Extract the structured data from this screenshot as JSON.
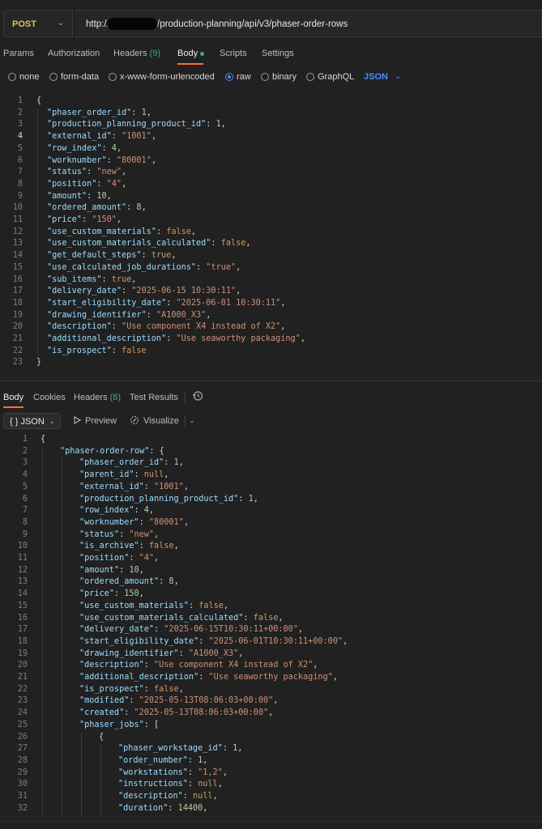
{
  "request": {
    "method": "POST",
    "url_host": "http://",
    "url_path": "/production-planning/api/v3/phaser-order-rows",
    "tabs": [
      {
        "label": "Params"
      },
      {
        "label": "Authorization"
      },
      {
        "label": "Headers",
        "count": "(9)"
      },
      {
        "label": "Body"
      },
      {
        "label": "Scripts"
      },
      {
        "label": "Settings"
      }
    ],
    "body_types": [
      "none",
      "form-data",
      "x-www-form-urlencoded",
      "raw",
      "binary",
      "GraphQL"
    ],
    "selected_body_type": "raw",
    "language": "JSON"
  },
  "request_body_lines": [
    [
      [
        "p",
        "{"
      ]
    ],
    [
      [
        "k",
        "\"phaser_order_id\""
      ],
      [
        "p",
        ": "
      ],
      [
        "n",
        "1"
      ],
      [
        "p",
        ","
      ]
    ],
    [
      [
        "k",
        "\"production_planning_product_id\""
      ],
      [
        "p",
        ": "
      ],
      [
        "n",
        "1"
      ],
      [
        "p",
        ","
      ]
    ],
    [
      [
        "k",
        "\"external_id\""
      ],
      [
        "p",
        ": "
      ],
      [
        "s",
        "\"1001\""
      ],
      [
        "p",
        ","
      ]
    ],
    [
      [
        "k",
        "\"row_index\""
      ],
      [
        "p",
        ": "
      ],
      [
        "n",
        "4"
      ],
      [
        "p",
        ","
      ]
    ],
    [
      [
        "k",
        "\"worknumber\""
      ],
      [
        "p",
        ": "
      ],
      [
        "s",
        "\"80001\""
      ],
      [
        "p",
        ","
      ]
    ],
    [
      [
        "k",
        "\"status\""
      ],
      [
        "p",
        ": "
      ],
      [
        "s",
        "\"new\""
      ],
      [
        "p",
        ","
      ]
    ],
    [
      [
        "k",
        "\"position\""
      ],
      [
        "p",
        ": "
      ],
      [
        "s",
        "\"4\""
      ],
      [
        "p",
        ","
      ]
    ],
    [
      [
        "k",
        "\"amount\""
      ],
      [
        "p",
        ": "
      ],
      [
        "n",
        "10"
      ],
      [
        "p",
        ","
      ]
    ],
    [
      [
        "k",
        "\"ordered_amount\""
      ],
      [
        "p",
        ": "
      ],
      [
        "n",
        "8"
      ],
      [
        "p",
        ","
      ]
    ],
    [
      [
        "k",
        "\"price\""
      ],
      [
        "p",
        ": "
      ],
      [
        "s",
        "\"150\""
      ],
      [
        "p",
        ","
      ]
    ],
    [
      [
        "k",
        "\"use_custom_materials\""
      ],
      [
        "p",
        ": "
      ],
      [
        "b",
        "false"
      ],
      [
        "p",
        ","
      ]
    ],
    [
      [
        "k",
        "\"use_custom_materials_calculated\""
      ],
      [
        "p",
        ": "
      ],
      [
        "b",
        "false"
      ],
      [
        "p",
        ","
      ]
    ],
    [
      [
        "k",
        "\"get_default_steps\""
      ],
      [
        "p",
        ": "
      ],
      [
        "b",
        "true"
      ],
      [
        "p",
        ","
      ]
    ],
    [
      [
        "k",
        "\"use_calculated_job_durations\""
      ],
      [
        "p",
        ": "
      ],
      [
        "s",
        "\"true\""
      ],
      [
        "p",
        ","
      ]
    ],
    [
      [
        "k",
        "\"sub_items\""
      ],
      [
        "p",
        ": "
      ],
      [
        "b",
        "true"
      ],
      [
        "p",
        ","
      ]
    ],
    [
      [
        "k",
        "\"delivery_date\""
      ],
      [
        "p",
        ": "
      ],
      [
        "s",
        "\"2025-06-15 10:30:11\""
      ],
      [
        "p",
        ","
      ]
    ],
    [
      [
        "k",
        "\"start_eligibility_date\""
      ],
      [
        "p",
        ": "
      ],
      [
        "s",
        "\"2025-06-01 10:30:11\""
      ],
      [
        "p",
        ","
      ]
    ],
    [
      [
        "k",
        "\"drawing_identifier\""
      ],
      [
        "p",
        ": "
      ],
      [
        "s",
        "\"A1000_X3\""
      ],
      [
        "p",
        ","
      ]
    ],
    [
      [
        "k",
        "\"description\""
      ],
      [
        "p",
        ": "
      ],
      [
        "s",
        "\"Use component X4 instead of X2\""
      ],
      [
        "p",
        ","
      ]
    ],
    [
      [
        "k",
        "\"additional_description\""
      ],
      [
        "p",
        ": "
      ],
      [
        "s",
        "\"Use seaworthy packaging\""
      ],
      [
        "p",
        ","
      ]
    ],
    [
      [
        "k",
        "\"is_prospect\""
      ],
      [
        "p",
        ": "
      ],
      [
        "b",
        "false"
      ]
    ],
    [
      [
        "p",
        "}"
      ]
    ]
  ],
  "response": {
    "tabs": [
      {
        "label": "Body"
      },
      {
        "label": "Cookies"
      },
      {
        "label": "Headers",
        "count": "(8)"
      },
      {
        "label": "Test Results"
      }
    ],
    "format": "{ } JSON",
    "preview": "Preview",
    "visualize": "Visualize"
  },
  "response_body_lines": [
    [
      [
        "p",
        "{"
      ]
    ],
    [
      [
        "k",
        "\"phaser-order-row\""
      ],
      [
        "p",
        ": {"
      ]
    ],
    [
      [
        "k",
        "\"phaser_order_id\""
      ],
      [
        "p",
        ": "
      ],
      [
        "n",
        "1"
      ],
      [
        "p",
        ","
      ]
    ],
    [
      [
        "k",
        "\"parent_id\""
      ],
      [
        "p",
        ": "
      ],
      [
        "b",
        "null"
      ],
      [
        "p",
        ","
      ]
    ],
    [
      [
        "k",
        "\"external_id\""
      ],
      [
        "p",
        ": "
      ],
      [
        "s",
        "\"1001\""
      ],
      [
        "p",
        ","
      ]
    ],
    [
      [
        "k",
        "\"production_planning_product_id\""
      ],
      [
        "p",
        ": "
      ],
      [
        "n",
        "1"
      ],
      [
        "p",
        ","
      ]
    ],
    [
      [
        "k",
        "\"row_index\""
      ],
      [
        "p",
        ": "
      ],
      [
        "n",
        "4"
      ],
      [
        "p",
        ","
      ]
    ],
    [
      [
        "k",
        "\"worknumber\""
      ],
      [
        "p",
        ": "
      ],
      [
        "s",
        "\"80001\""
      ],
      [
        "p",
        ","
      ]
    ],
    [
      [
        "k",
        "\"status\""
      ],
      [
        "p",
        ": "
      ],
      [
        "s",
        "\"new\""
      ],
      [
        "p",
        ","
      ]
    ],
    [
      [
        "k",
        "\"is_archive\""
      ],
      [
        "p",
        ": "
      ],
      [
        "b",
        "false"
      ],
      [
        "p",
        ","
      ]
    ],
    [
      [
        "k",
        "\"position\""
      ],
      [
        "p",
        ": "
      ],
      [
        "s",
        "\"4\""
      ],
      [
        "p",
        ","
      ]
    ],
    [
      [
        "k",
        "\"amount\""
      ],
      [
        "p",
        ": "
      ],
      [
        "n",
        "10"
      ],
      [
        "p",
        ","
      ]
    ],
    [
      [
        "k",
        "\"ordered_amount\""
      ],
      [
        "p",
        ": "
      ],
      [
        "n",
        "8"
      ],
      [
        "p",
        ","
      ]
    ],
    [
      [
        "k",
        "\"price\""
      ],
      [
        "p",
        ": "
      ],
      [
        "n",
        "150"
      ],
      [
        "p",
        ","
      ]
    ],
    [
      [
        "k",
        "\"use_custom_materials\""
      ],
      [
        "p",
        ": "
      ],
      [
        "b",
        "false"
      ],
      [
        "p",
        ","
      ]
    ],
    [
      [
        "k",
        "\"use_custom_materials_calculated\""
      ],
      [
        "p",
        ": "
      ],
      [
        "b",
        "false"
      ],
      [
        "p",
        ","
      ]
    ],
    [
      [
        "k",
        "\"delivery_date\""
      ],
      [
        "p",
        ": "
      ],
      [
        "s",
        "\"2025-06-15T10:30:11+00:00\""
      ],
      [
        "p",
        ","
      ]
    ],
    [
      [
        "k",
        "\"start_eligibility_date\""
      ],
      [
        "p",
        ": "
      ],
      [
        "s",
        "\"2025-06-01T10:30:11+00:00\""
      ],
      [
        "p",
        ","
      ]
    ],
    [
      [
        "k",
        "\"drawing_identifier\""
      ],
      [
        "p",
        ": "
      ],
      [
        "s",
        "\"A1000_X3\""
      ],
      [
        "p",
        ","
      ]
    ],
    [
      [
        "k",
        "\"description\""
      ],
      [
        "p",
        ": "
      ],
      [
        "s",
        "\"Use component X4 instead of X2\""
      ],
      [
        "p",
        ","
      ]
    ],
    [
      [
        "k",
        "\"additional_description\""
      ],
      [
        "p",
        ": "
      ],
      [
        "s",
        "\"Use seaworthy packaging\""
      ],
      [
        "p",
        ","
      ]
    ],
    [
      [
        "k",
        "\"is_prospect\""
      ],
      [
        "p",
        ": "
      ],
      [
        "b",
        "false"
      ],
      [
        "p",
        ","
      ]
    ],
    [
      [
        "k",
        "\"modified\""
      ],
      [
        "p",
        ": "
      ],
      [
        "s",
        "\"2025-05-13T08:06:03+00:00\""
      ],
      [
        "p",
        ","
      ]
    ],
    [
      [
        "k",
        "\"created\""
      ],
      [
        "p",
        ": "
      ],
      [
        "s",
        "\"2025-05-13T08:06:03+00:00\""
      ],
      [
        "p",
        ","
      ]
    ],
    [
      [
        "k",
        "\"phaser_jobs\""
      ],
      [
        "p",
        ": ["
      ]
    ],
    [
      [
        "p",
        "{"
      ]
    ],
    [
      [
        "k",
        "\"phaser_workstage_id\""
      ],
      [
        "p",
        ": "
      ],
      [
        "n",
        "1"
      ],
      [
        "p",
        ","
      ]
    ],
    [
      [
        "k",
        "\"order_number\""
      ],
      [
        "p",
        ": "
      ],
      [
        "n",
        "1"
      ],
      [
        "p",
        ","
      ]
    ],
    [
      [
        "k",
        "\"workstations\""
      ],
      [
        "p",
        ": "
      ],
      [
        "s",
        "\"1,2\""
      ],
      [
        "p",
        ","
      ]
    ],
    [
      [
        "k",
        "\"instructions\""
      ],
      [
        "p",
        ": "
      ],
      [
        "b",
        "null"
      ],
      [
        "p",
        ","
      ]
    ],
    [
      [
        "k",
        "\"description\""
      ],
      [
        "p",
        ": "
      ],
      [
        "b",
        "null"
      ],
      [
        "p",
        ","
      ]
    ],
    [
      [
        "k",
        "\"duration\""
      ],
      [
        "p",
        ": "
      ],
      [
        "n",
        "14400"
      ],
      [
        "p",
        ","
      ]
    ]
  ]
}
